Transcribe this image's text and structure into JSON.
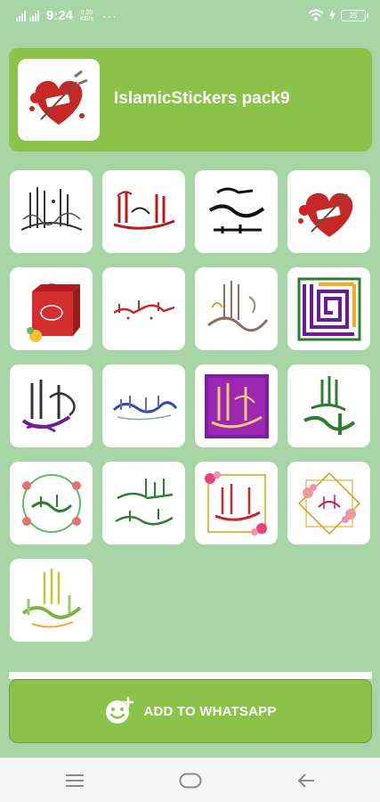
{
  "status_bar": {
    "network": "4G",
    "time": "9:24",
    "speed_value": "0.20",
    "speed_unit": "KB/s",
    "more": "···",
    "battery": "25"
  },
  "pack": {
    "title": "IslamicStickers pack9"
  },
  "stickers": [
    {
      "name": "sticker-calligraphy-la-quwwata",
      "color": "#333333"
    },
    {
      "name": "sticker-alhamdulillah-red",
      "color": "#b71c1c"
    },
    {
      "name": "sticker-dawat-tabligh",
      "color": "#111111"
    },
    {
      "name": "sticker-heart-splash",
      "color": "#c62828"
    },
    {
      "name": "sticker-gift-bag",
      "color": "#d32f2f"
    },
    {
      "name": "sticker-jazakallah-khair",
      "color": "#c62828"
    },
    {
      "name": "sticker-tawakkaltu-alallah",
      "color": "#8d6e63"
    },
    {
      "name": "sticker-kufic-square",
      "color": "#2e7d32"
    },
    {
      "name": "sticker-eid-mubarak",
      "color": "#6a1b9a"
    },
    {
      "name": "sticker-subhanallah",
      "color": "#3949ab"
    },
    {
      "name": "sticker-inshallah-purple",
      "color": "#7b1fa2"
    },
    {
      "name": "sticker-allahu-akbar",
      "color": "#2e7d32"
    },
    {
      "name": "sticker-mashallah-wreath",
      "color": "#2e7d32"
    },
    {
      "name": "sticker-walaikum-assalam",
      "color": "#2e7d32"
    },
    {
      "name": "sticker-alhamdulillah-floral",
      "color": "#c62828"
    },
    {
      "name": "sticker-floral-frame",
      "color": "#c2185b"
    },
    {
      "name": "sticker-astaghfirullah",
      "color": "#7cb342"
    }
  ],
  "actions": {
    "add_to_whatsapp": "ADD TO WHATSAPP"
  },
  "colors": {
    "background": "#a8d5a6",
    "accent": "#8bc34a"
  }
}
